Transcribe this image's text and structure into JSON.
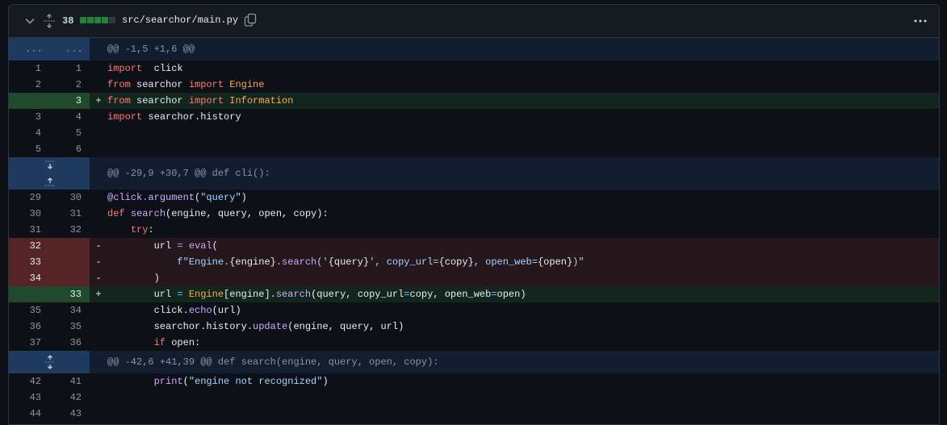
{
  "header": {
    "change_count": "38",
    "file_path": "src/searchor/main.py",
    "diffstat_colors": [
      "#238636",
      "#238636",
      "#238636",
      "#238636",
      "#30363d"
    ]
  },
  "hunks": [
    {
      "ellipsis_old": "...",
      "ellipsis_new": "...",
      "text": "@@ -1,5 +1,6 @@"
    },
    {
      "text": "@@ -29,9 +30,7 @@ def cli():"
    },
    {
      "text": "@@ -42,6 +41,39 @@ def search(engine, query, open, copy):"
    }
  ],
  "block1": [
    {
      "old": "1",
      "new": "1",
      "marker": "",
      "segs": [
        [
          "k",
          "import"
        ],
        [
          "",
          "  click"
        ]
      ]
    },
    {
      "old": "2",
      "new": "2",
      "marker": "",
      "segs": [
        [
          "k",
          "from"
        ],
        [
          "",
          " searchor "
        ],
        [
          "k",
          "import"
        ],
        [
          "",
          " "
        ],
        [
          "c",
          "Engine"
        ]
      ]
    },
    {
      "old": "",
      "new": "3",
      "marker": "+",
      "type": "add",
      "segs": [
        [
          "k",
          "from"
        ],
        [
          "",
          " searchor "
        ],
        [
          "k",
          "import"
        ],
        [
          "",
          " "
        ],
        [
          "c",
          "Information"
        ]
      ]
    },
    {
      "old": "3",
      "new": "4",
      "marker": "",
      "segs": [
        [
          "k",
          "import"
        ],
        [
          "",
          " searchor.history"
        ]
      ]
    },
    {
      "old": "4",
      "new": "5",
      "marker": "",
      "segs": []
    },
    {
      "old": "5",
      "new": "6",
      "marker": "",
      "segs": []
    }
  ],
  "block2": [
    {
      "old": "29",
      "new": "30",
      "marker": "",
      "segs": [
        [
          "f",
          "@click"
        ],
        [
          "",
          ""
        ],
        [
          "o",
          "."
        ],
        [
          "f",
          "argument"
        ],
        [
          "",
          "("
        ],
        [
          "s",
          "\"query\""
        ],
        [
          "",
          ")"
        ]
      ]
    },
    {
      "old": "30",
      "new": "31",
      "marker": "",
      "segs": [
        [
          "k",
          "def"
        ],
        [
          "",
          " "
        ],
        [
          "f",
          "search"
        ],
        [
          "",
          "(engine, query, open, copy):"
        ]
      ]
    },
    {
      "old": "31",
      "new": "32",
      "marker": "",
      "segs": [
        [
          "",
          "    "
        ],
        [
          "k",
          "try"
        ],
        [
          "",
          ":"
        ]
      ]
    },
    {
      "old": "32",
      "new": "",
      "marker": "-",
      "type": "del",
      "segs": [
        [
          "",
          "        url "
        ],
        [
          "o",
          "="
        ],
        [
          "",
          " "
        ],
        [
          "f",
          "eval"
        ],
        [
          "",
          "("
        ]
      ]
    },
    {
      "old": "33",
      "new": "",
      "marker": "-",
      "type": "del",
      "segs": [
        [
          "",
          "            "
        ],
        [
          "s",
          "f\"Engine."
        ],
        [
          "",
          "{engine}"
        ],
        [
          "s",
          "."
        ],
        [
          "f",
          "search"
        ],
        [
          "s",
          "('"
        ],
        [
          "",
          "{query}"
        ],
        [
          "s",
          "', copy_url="
        ],
        [
          "",
          "{copy}"
        ],
        [
          "s",
          ", open_web="
        ],
        [
          "",
          "{open}"
        ],
        [
          "s",
          ")\""
        ]
      ]
    },
    {
      "old": "34",
      "new": "",
      "marker": "-",
      "type": "del",
      "segs": [
        [
          "",
          "        )"
        ]
      ]
    },
    {
      "old": "",
      "new": "33",
      "marker": "+",
      "type": "add",
      "segs": [
        [
          "",
          "        url "
        ],
        [
          "o",
          "="
        ],
        [
          "",
          " "
        ],
        [
          "c",
          "Engine"
        ],
        [
          "",
          "[engine]."
        ],
        [
          "f",
          "search"
        ],
        [
          "",
          "(query, copy_url"
        ],
        [
          "o",
          "="
        ],
        [
          "",
          "copy, open_web"
        ],
        [
          "o",
          "="
        ],
        [
          "",
          "open)"
        ]
      ]
    },
    {
      "old": "35",
      "new": "34",
      "marker": "",
      "segs": [
        [
          "",
          "        click."
        ],
        [
          "f",
          "echo"
        ],
        [
          "",
          "(url)"
        ]
      ]
    },
    {
      "old": "36",
      "new": "35",
      "marker": "",
      "segs": [
        [
          "",
          "        searchor.history."
        ],
        [
          "f",
          "update"
        ],
        [
          "",
          "(engine, query, url)"
        ]
      ]
    },
    {
      "old": "37",
      "new": "36",
      "marker": "",
      "segs": [
        [
          "",
          "        "
        ],
        [
          "k",
          "if"
        ],
        [
          "",
          " open:"
        ]
      ]
    }
  ],
  "block3": [
    {
      "old": "42",
      "new": "41",
      "marker": "",
      "segs": [
        [
          "",
          "        "
        ],
        [
          "f",
          "print"
        ],
        [
          "",
          "("
        ],
        [
          "s",
          "\"engine not recognized\""
        ],
        [
          "",
          ")"
        ]
      ]
    },
    {
      "old": "43",
      "new": "42",
      "marker": "",
      "segs": []
    },
    {
      "old": "44",
      "new": "43",
      "marker": "",
      "segs": []
    }
  ]
}
